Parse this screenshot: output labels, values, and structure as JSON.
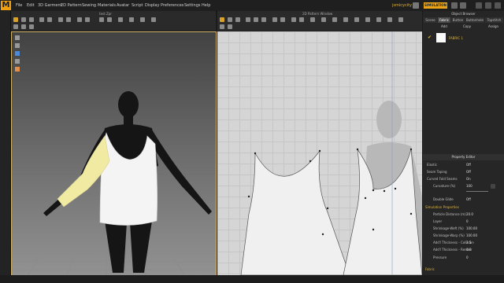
{
  "menu": {
    "logo": "M",
    "items": [
      "File",
      "Edit",
      "3D Garment",
      "2D Pattern",
      "Sewing",
      "Materials",
      "Avatar",
      "Script",
      "Display",
      "Preferences",
      "Settings",
      "Help"
    ],
    "user": "jsmicycity",
    "sim_badge": "SIMULATION"
  },
  "toolbar_3d": {
    "title": "test.Zpr"
  },
  "toolbar_2d": {
    "title": "2D Pattern Window"
  },
  "right_panel": {
    "browser_title": "Object Browser",
    "tabs": [
      "Scene",
      "Fabric",
      "Button",
      "Buttonhole",
      "Topstitch"
    ],
    "actions": [
      "Add",
      "Copy",
      "Assign"
    ],
    "fabric_name": "FABRIC 1",
    "property_title": "Property Editor",
    "rows": [
      {
        "label": "Elastic",
        "value": "Off",
        "type": "check"
      },
      {
        "label": "Seam Taping",
        "value": "Off",
        "type": "check"
      },
      {
        "label": "Curved Fold Seams",
        "value": "On",
        "type": "check"
      },
      {
        "label": "Curvature (%)",
        "value": "100",
        "type": "slider"
      },
      {
        "label": "Double Glide",
        "value": "Off",
        "type": "check"
      }
    ],
    "sim_section": "Simulation Properties",
    "sim_rows": [
      {
        "label": "Particle Distance (m)",
        "value": "20.0"
      },
      {
        "label": "Layer",
        "value": "0"
      },
      {
        "label": "Shrinkage-Weft (%)",
        "value": "100.00"
      },
      {
        "label": "Shrinkage-Warp (%)",
        "value": "100.00"
      },
      {
        "label": "Add'l Thickness - Collision",
        "value": "2.5"
      },
      {
        "label": "Add'l Thickness - Render",
        "value": "0.0"
      },
      {
        "label": "Pressure",
        "value": "0"
      }
    ],
    "fabric_section": "Fabric"
  },
  "colors": {
    "accent": "#e9a418",
    "viewport_border": "#d3b36a",
    "sleeve": "#f1eaa3"
  }
}
